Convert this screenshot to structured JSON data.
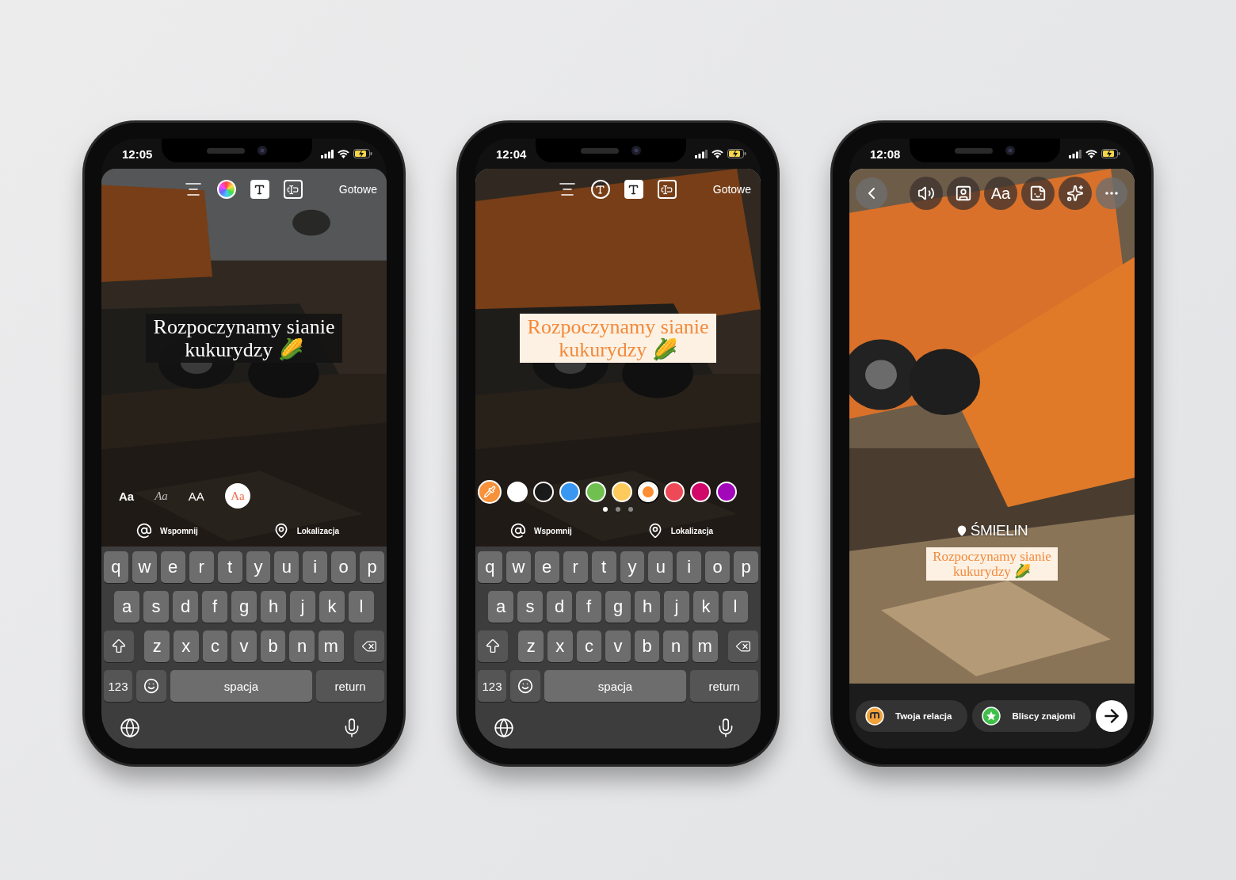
{
  "phones": [
    {
      "kind": "editor",
      "time": "12:05",
      "toolbar": {
        "tools": [
          {
            "kind": "align"
          },
          {
            "kind": "color-wheel"
          },
          {
            "kind": "effects"
          },
          {
            "kind": "animate"
          }
        ],
        "done": "Gotowe"
      },
      "caption": {
        "kind": "dark",
        "lines": [
          "Rozpoczynamy sianie",
          "kukurydzy 🌽"
        ]
      },
      "picker": {
        "kind": "fonts",
        "fonts": [
          {
            "kind": "sans-bold",
            "label": "Aa",
            "selected": false
          },
          {
            "kind": "serif-italic",
            "label": "Aa",
            "selected": false
          },
          {
            "kind": "caps",
            "label": "AA",
            "selected": false
          },
          {
            "kind": "serif",
            "label": "Aa",
            "selected": true
          }
        ]
      },
      "tags": [
        {
          "kind": "mention",
          "label": "Wspomnij"
        },
        {
          "kind": "location",
          "label": "Lokalizacja"
        }
      ],
      "keyboard": {
        "rows": [
          [
            "q",
            "w",
            "e",
            "r",
            "t",
            "y",
            "u",
            "i",
            "o",
            "p"
          ],
          [
            "a",
            "s",
            "d",
            "f",
            "g",
            "h",
            "j",
            "k",
            "l"
          ],
          [
            "z",
            "x",
            "c",
            "v",
            "b",
            "n",
            "m"
          ]
        ],
        "numbers": "123",
        "space": "spacja",
        "return": "return"
      }
    },
    {
      "kind": "editor",
      "time": "12:04",
      "toolbar": {
        "tools": [
          {
            "kind": "align"
          },
          {
            "kind": "letter-circle"
          },
          {
            "kind": "effects"
          },
          {
            "kind": "animate"
          }
        ],
        "done": "Gotowe"
      },
      "caption": {
        "kind": "cream",
        "lines": [
          "Rozpoczynamy sianie",
          "kukurydzy 🌽"
        ]
      },
      "picker": {
        "kind": "colors",
        "colors": [
          {
            "color": "#ffffff",
            "selected": false
          },
          {
            "color": "#1a1a1a",
            "selected": false
          },
          {
            "color": "#3897f0",
            "selected": false
          },
          {
            "color": "#70c050",
            "selected": false
          },
          {
            "color": "#fdcb5c",
            "selected": false
          },
          {
            "color": "#fd8d32",
            "selected": true
          },
          {
            "color": "#ed4956",
            "selected": false
          },
          {
            "color": "#d10869",
            "selected": false
          },
          {
            "color": "#a307ba",
            "selected": false
          }
        ]
      },
      "tags": [
        {
          "kind": "mention",
          "label": "Wspomnij"
        },
        {
          "kind": "location",
          "label": "Lokalizacja"
        }
      ],
      "keyboard": {
        "rows": [
          [
            "q",
            "w",
            "e",
            "r",
            "t",
            "y",
            "u",
            "i",
            "o",
            "p"
          ],
          [
            "a",
            "s",
            "d",
            "f",
            "g",
            "h",
            "j",
            "k",
            "l"
          ],
          [
            "z",
            "x",
            "c",
            "v",
            "b",
            "n",
            "m"
          ]
        ],
        "numbers": "123",
        "space": "spacja",
        "return": "return"
      }
    },
    {
      "kind": "story",
      "time": "12:08",
      "text_tool": "Aa",
      "location": "ŚMIELIN",
      "caption": {
        "kind": "cream",
        "lines": [
          "Rozpoczynamy sianie",
          "kukurydzy 🌽"
        ]
      },
      "share": [
        {
          "kind": "story",
          "label": "Twoja relacja"
        },
        {
          "kind": "close-friends",
          "label": "Bliscy znajomi"
        }
      ]
    }
  ]
}
